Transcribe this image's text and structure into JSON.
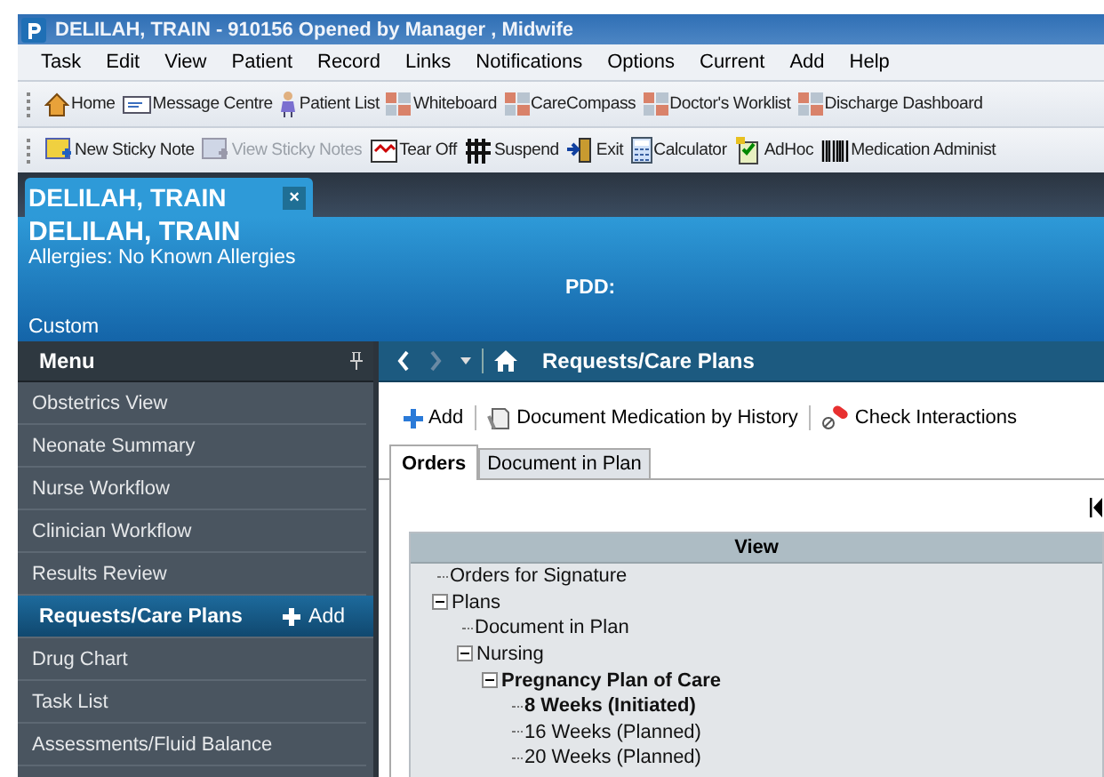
{
  "window": {
    "title": "DELILAH, TRAIN  - 910156 Opened by Manager , Midwife"
  },
  "menu_bar": [
    "Task",
    "Edit",
    "View",
    "Patient",
    "Record",
    "Links",
    "Notifications",
    "Options",
    "Current",
    "Add",
    "Help"
  ],
  "toolbar_1": [
    {
      "label": "Home",
      "kind": "home",
      "disabled": false
    },
    {
      "label": "Message Centre",
      "kind": "message",
      "disabled": false
    },
    {
      "label": "Patient List",
      "kind": "person",
      "disabled": false
    },
    {
      "label": "Whiteboard",
      "kind": "grid",
      "disabled": false
    },
    {
      "label": "CareCompass",
      "kind": "grid",
      "disabled": false
    },
    {
      "label": "Doctor's Worklist",
      "kind": "grid",
      "disabled": false
    },
    {
      "label": "Discharge Dashboard",
      "kind": "grid",
      "disabled": false
    }
  ],
  "toolbar_2": [
    {
      "label": "New Sticky Note",
      "kind": "note",
      "disabled": false
    },
    {
      "label": "View Sticky Notes",
      "kind": "note",
      "disabled": true
    },
    {
      "label": "Tear Off",
      "kind": "tear",
      "disabled": false
    },
    {
      "label": "Suspend",
      "kind": "suspend",
      "disabled": false
    },
    {
      "label": "Exit",
      "kind": "exit",
      "disabled": false
    },
    {
      "label": "Calculator",
      "kind": "calculator",
      "disabled": false
    },
    {
      "label": "AdHoc",
      "kind": "adhoc",
      "disabled": false
    },
    {
      "label": "Medication Administ",
      "kind": "barcode",
      "disabled": false
    }
  ],
  "patient_tab": {
    "label": "DELILAH, TRAIN",
    "close": "×"
  },
  "banner": {
    "name": "DELILAH, TRAIN",
    "allergies": "Allergies: No Known Allergies",
    "pdd": "PDD:",
    "custom": "Custom"
  },
  "sidebar": {
    "title": "Menu",
    "items": [
      {
        "label": "Obstetrics View",
        "selected": false
      },
      {
        "label": "Neonate Summary",
        "selected": false
      },
      {
        "label": "Nurse Workflow",
        "selected": false
      },
      {
        "label": "Clinician Workflow",
        "selected": false
      },
      {
        "label": "Results Review",
        "selected": false
      },
      {
        "label": "Requests/Care Plans",
        "selected": true,
        "action": "Add"
      },
      {
        "label": "Drug Chart",
        "selected": false
      },
      {
        "label": "Task List",
        "selected": false
      },
      {
        "label": "Assessments/Fluid Balance",
        "selected": false
      }
    ]
  },
  "content": {
    "title": "Requests/Care Plans",
    "actions": [
      {
        "label": "Add",
        "kind": "plus"
      },
      {
        "label": "Document Medication by History",
        "kind": "document"
      },
      {
        "label": "Check Interactions",
        "kind": "pills"
      }
    ],
    "tabs": [
      {
        "label": "Orders",
        "selected": true
      },
      {
        "label": "Document in Plan",
        "selected": false
      }
    ],
    "tree_header": "View",
    "tree": [
      {
        "label": "Orders for Signature",
        "bold": false
      },
      {
        "label": "Plans",
        "bold": false,
        "expanded": true,
        "children": [
          {
            "label": "Document in Plan",
            "bold": false
          },
          {
            "label": "Nursing",
            "bold": false,
            "expanded": true,
            "children": [
              {
                "label": "Pregnancy Plan of Care",
                "bold": true,
                "expanded": true,
                "children": [
                  {
                    "label": "8 Weeks (Initiated)",
                    "bold": true
                  },
                  {
                    "label": "16 Weeks (Planned)",
                    "bold": false
                  },
                  {
                    "label": "20 Weeks (Planned)",
                    "bold": false
                  }
                ]
              }
            ]
          }
        ]
      }
    ]
  }
}
